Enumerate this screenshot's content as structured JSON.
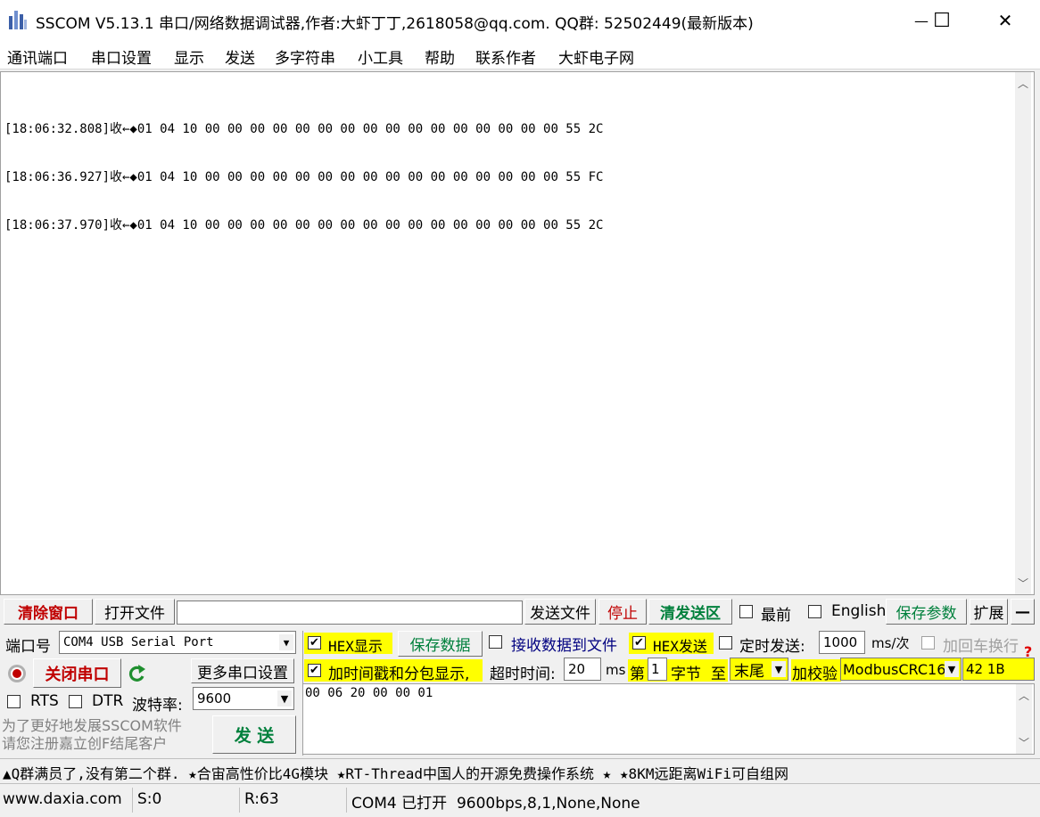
{
  "window": {
    "title": "SSCOM V5.13.1 串口/网络数据调试器,作者:大虾丁丁,2618058@qq.com. QQ群:  52502449(最新版本)",
    "minimize": "—",
    "maximize": "☐",
    "close": "✕"
  },
  "menu": [
    "通讯端口",
    "串口设置",
    "显示",
    "发送",
    "多字符串",
    "小工具",
    "帮助",
    "联系作者",
    "大虾电子网"
  ],
  "receive": {
    "lines": [
      "[18:06:32.808]收←◆01 04 10 00 00 00 00 00 00 00 00 00 00 00 00 00 00 00 00 55 2C",
      "[18:06:36.927]收←◆01 04 10 00 00 00 00 00 00 00 00 00 00 00 00 00 00 00 00 55 FC",
      "[18:06:37.970]收←◆01 04 10 00 00 00 00 00 00 00 00 00 00 00 00 00 00 00 00 55 2C"
    ]
  },
  "toolbar": {
    "clear_window": "清除窗口",
    "open_file": "打开文件",
    "file_path": "",
    "send_file": "发送文件",
    "stop": "停止",
    "clear_send": "清发送区",
    "topmost": "最前",
    "english": "English",
    "save_params": "保存参数",
    "expand": "扩展",
    "collapse": "—"
  },
  "port": {
    "port_label": "端口号",
    "port_value": "COM4 USB Serial Port",
    "close_port": "关闭串口",
    "more_settings": "更多串口设置",
    "rts": "RTS",
    "dtr": "DTR",
    "baud_label": "波特率:",
    "baud_value": "9600",
    "promo_line1": "为了更好地发展SSCOM软件",
    "promo_line2": "请您注册嘉立创F结尾客户",
    "send": "发  送"
  },
  "options": {
    "hex_display": "HEX显示",
    "save_data": "保存数据",
    "recv_to_file": "接收数据到文件",
    "hex_send": "HEX发送",
    "timed_send": "定时发送:",
    "interval": "1000",
    "interval_unit": "ms/次",
    "add_crlf": "加回车换行",
    "timestamp": "加时间戳和分包显示,",
    "timeout_label": "超时时间:",
    "timeout_value": "20",
    "timeout_unit": "ms",
    "nth": "第",
    "byte_start": "1",
    "byte_word": "字节",
    "to": "至",
    "end_value": "末尾",
    "checksum_label": "加校验",
    "checksum_value": "ModbusCRC16",
    "checksum_result": "42 1B",
    "help": "?"
  },
  "send_area": {
    "text": "00 06 20 00 00 01"
  },
  "ticker": "▲Q群满员了,没有第二个群. ★合宙高性价比4G模块 ★RT-Thread中国人的开源免费操作系统 ★ ★8KM远距离WiFi可自组网",
  "status": {
    "site": "www.daxia.com",
    "sent": "S:0",
    "received": "R:63",
    "port_state": "COM4 已打开  9600bps,8,1,None,None"
  },
  "colors": {
    "red_text": "#c00000",
    "green_text": "#00803c",
    "navy_text": "#000080",
    "highlight": "#ffff00"
  },
  "icons": {
    "app": "app-icon",
    "record": "record-icon",
    "refresh": "refresh-icon",
    "checked": "check-icon"
  }
}
